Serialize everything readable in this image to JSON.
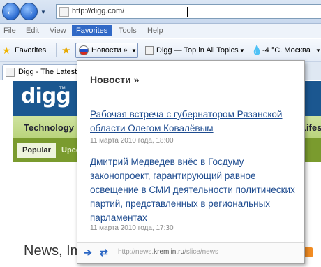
{
  "browser": {
    "address": {
      "url_prefix": "http://",
      "url_host": "digg.com/",
      "url": "http://digg.com/"
    },
    "menu": [
      "File",
      "Edit",
      "View",
      "Favorites",
      "Tools",
      "Help"
    ],
    "favorites_bar": {
      "favorites_label": "Favorites",
      "news_chip": "Новости »",
      "digg_chip": "Digg — Top in All Topics",
      "weather_chip": "-4 °C. Москва"
    },
    "tab": {
      "label": "Digg - The Latest News"
    }
  },
  "page": {
    "logo": "digg",
    "logo_tm": "TM",
    "topics": {
      "technology": "Technology",
      "lifestyle": "Lifestyle"
    },
    "subnav": {
      "popular": "Popular",
      "upcoming": "Upcoming"
    },
    "heading": "News, Im"
  },
  "popup": {
    "title": "Новости »",
    "items": [
      {
        "title": "Рабочая встреча с губернатором Рязанской области Олегом Ковалёвым",
        "date": "11 марта 2010 года, 18:00"
      },
      {
        "title": "Дмитрий Медведев внёс в Госдуму законопроект, гарантирующий равное освещение в СМИ деятельности политических партий, представленных в региональных парламентах",
        "date": "11 марта 2010 года, 17:30"
      }
    ],
    "footer": {
      "url_prefix": "http://news.",
      "url_host": "kremlin.ru",
      "url_path": "/slice/news"
    }
  },
  "colors": {
    "accent": "#3169c6",
    "link": "#1d4b8f",
    "digg_blue": "#1b5790",
    "digg_green": "#7a9b2e"
  }
}
